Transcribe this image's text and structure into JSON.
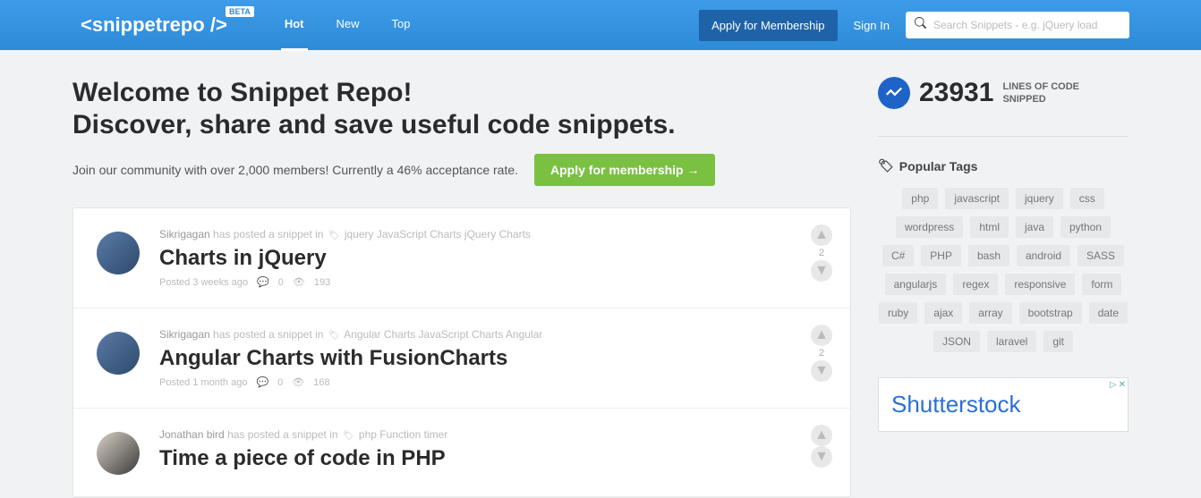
{
  "header": {
    "logo": "<snippetrepo />",
    "beta": "BETA",
    "nav": {
      "hot": "Hot",
      "new": "New",
      "top": "Top"
    },
    "apply": "Apply for Membership",
    "signin": "Sign In",
    "search_placeholder": "Search Snippets - e.g. jQuery load"
  },
  "hero": {
    "title_line1": "Welcome to Snippet Repo!",
    "title_line2": "Discover, share and save useful code snippets.",
    "sub": "Join our community with over 2,000 members! Currently a 46% acceptance rate.",
    "cta": "Apply for membership →"
  },
  "posts": [
    {
      "author": "Sikrigagan",
      "meta_text": "has posted a snippet in",
      "tags": "jquery JavaScript Charts jQuery Charts",
      "title": "Charts in jQuery",
      "posted": "Posted 3 weeks ago",
      "comments": "0",
      "views": "193",
      "votes": "2"
    },
    {
      "author": "Sikrigagan",
      "meta_text": "has posted a snippet in",
      "tags": "Angular Charts JavaScript Charts Angular",
      "title": "Angular Charts with FusionCharts",
      "posted": "Posted 1 month ago",
      "comments": "0",
      "views": "168",
      "votes": "2"
    },
    {
      "author": "Jonathan bird",
      "meta_text": "has posted a snippet in",
      "tags": "php Function timer",
      "title": "Time a piece of code in PHP",
      "posted": "",
      "comments": "",
      "views": "",
      "votes": ""
    }
  ],
  "stats": {
    "value": "23931",
    "label1": "LINES OF CODE",
    "label2": "SNIPPED"
  },
  "popular": {
    "heading": "Popular Tags",
    "tags": [
      "php",
      "javascript",
      "jquery",
      "css",
      "wordpress",
      "html",
      "java",
      "python",
      "C#",
      "PHP",
      "bash",
      "android",
      "SASS",
      "angularjs",
      "regex",
      "responsive",
      "form",
      "ruby",
      "ajax",
      "array",
      "bootstrap",
      "date",
      "JSON",
      "laravel",
      "git"
    ]
  },
  "ad": {
    "brand": "Shutterstock"
  }
}
